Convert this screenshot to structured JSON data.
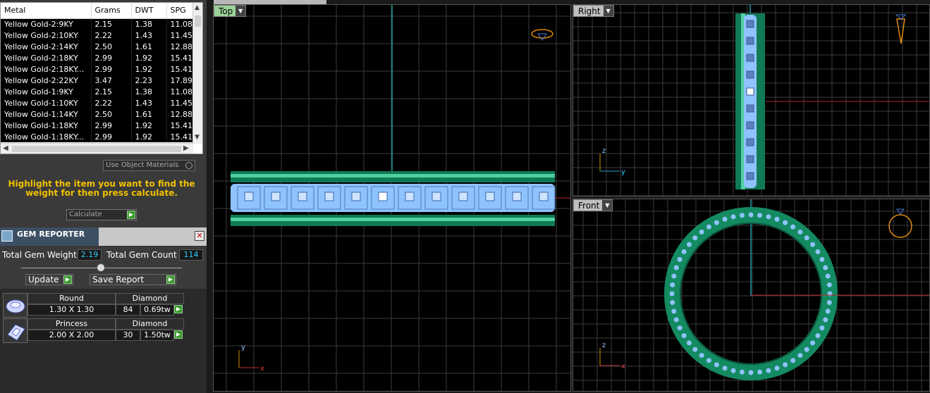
{
  "metal_table": {
    "headers": [
      "Metal",
      "Grams",
      "DWT",
      "SPG"
    ],
    "rows": [
      [
        "Yellow Gold-2:9KY",
        "2.15",
        "1.38",
        "11.08"
      ],
      [
        "Yellow Gold-2:10KY",
        "2.22",
        "1.43",
        "11.45"
      ],
      [
        "Yellow Gold-2:14KY",
        "2.50",
        "1.61",
        "12.88"
      ],
      [
        "Yellow Gold-2:18KY",
        "2.99",
        "1.92",
        "15.41"
      ],
      [
        "Yellow Gold-2:18KY...",
        "2.99",
        "1.92",
        "15.41"
      ],
      [
        "Yellow Gold-2:22KY",
        "3.47",
        "2.23",
        "17.89"
      ],
      [
        "Yellow Gold-1:9KY",
        "2.15",
        "1.38",
        "11.08"
      ],
      [
        "Yellow Gold-1:10KY",
        "2.22",
        "1.43",
        "11.45"
      ],
      [
        "Yellow Gold-1:14KY",
        "2.50",
        "1.61",
        "12.88"
      ],
      [
        "Yellow Gold-1:18KY",
        "2.99",
        "1.92",
        "15.41"
      ],
      [
        "Yellow Gold-1:18KY...",
        "2.99",
        "1.92",
        "15.41"
      ]
    ]
  },
  "use_object_materials": "Use Object Materials",
  "hint_text": "Highlight the item you want to find the weight for then press calculate.",
  "calculate_label": "Calculate",
  "gem_reporter": {
    "title": "GEM REPORTER",
    "close": "✕",
    "total_weight_label": "Total Gem Weight",
    "total_weight_value": "2.19",
    "total_count_label": "Total Gem Count",
    "total_count_value": "114",
    "update_label": "Update",
    "save_report_label": "Save Report",
    "gems": [
      {
        "shape": "Round",
        "type": "Diamond",
        "size": "1.30 X 1.30",
        "count": "84",
        "weight": "0.69tw"
      },
      {
        "shape": "Princess",
        "type": "Diamond",
        "size": "2.00 X 2.00",
        "count": "30",
        "weight": "1.50tw"
      }
    ]
  },
  "viewports": {
    "top": {
      "label": "Top"
    },
    "right": {
      "label": "Right"
    },
    "front": {
      "label": "Front"
    }
  },
  "axes": {
    "y": "y",
    "x": "x",
    "z": "z"
  },
  "colors": {
    "accent_green": "#9bd39a",
    "hint_yellow": "#f0c000",
    "value_cyan": "#2ad0ff",
    "band_green": "#1e9a6a",
    "gem_blue": "#8fc3ff"
  }
}
